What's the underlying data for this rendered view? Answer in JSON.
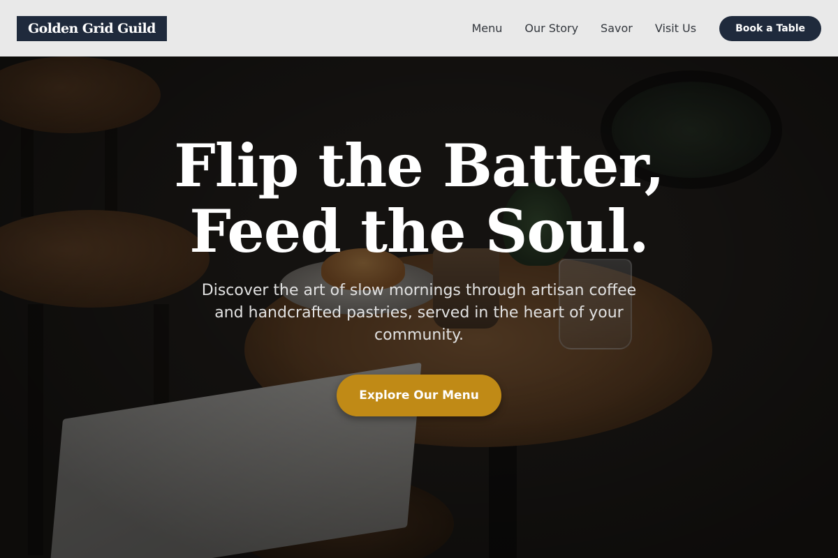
{
  "header": {
    "brand": "Golden Grid Guild",
    "nav": {
      "menu": "Menu",
      "our_story": "Our Story",
      "savor": "Savor",
      "visit_us": "Visit Us"
    },
    "cta": "Book a Table"
  },
  "hero": {
    "title_line1": "Flip the Batter,",
    "title_line2": "Feed the Soul.",
    "subtitle": "Discover the art of slow mornings through artisan coffee and handcrafted pastries, served in the heart of your community.",
    "cta": "Explore Our Menu"
  },
  "colors": {
    "header_bg": "#e9e9e9",
    "navy": "#1f2a3c",
    "gold": "#c08a16",
    "nav_text": "#33373d"
  }
}
